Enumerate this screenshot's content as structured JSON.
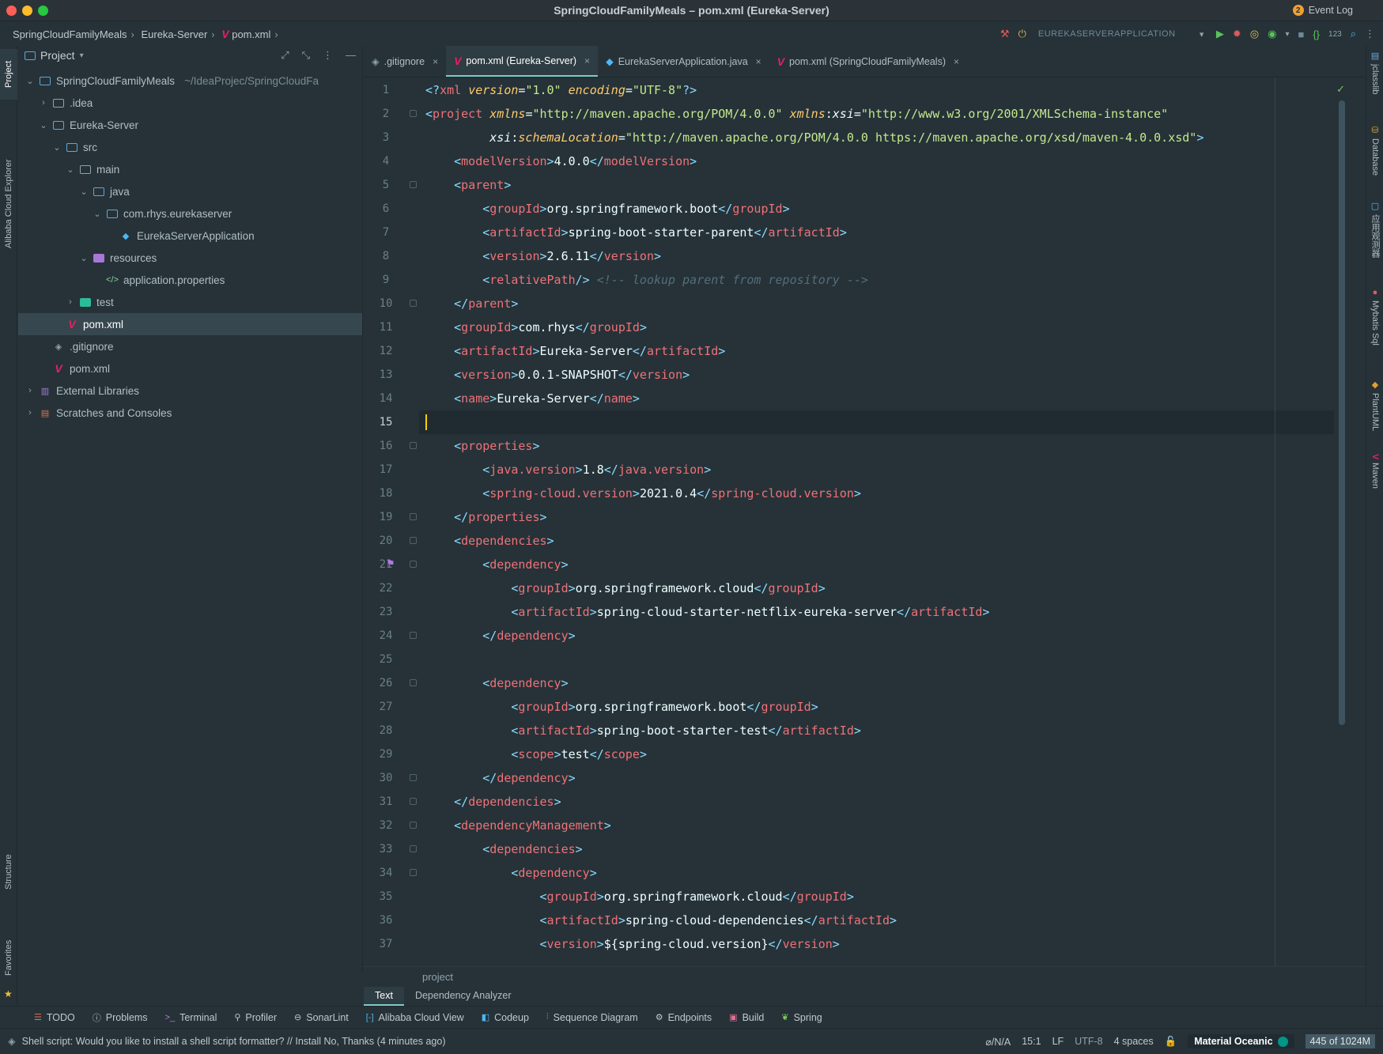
{
  "window": {
    "title": "SpringCloudFamilyMeals – pom.xml (Eureka-Server)"
  },
  "breadcrumb": [
    "SpringCloudFamilyMeals",
    "Eureka-Server",
    "pom.xml"
  ],
  "toolbar": {
    "run_config": "EUREKASERVERAPPLICATION",
    "counter_label": "123"
  },
  "left_strip": {
    "project": "Project",
    "alibaba": "Alibaba Cloud Explorer",
    "structure": "Structure",
    "favorites": "Favorites"
  },
  "project_panel": {
    "title": "Project",
    "tree": [
      {
        "label": "SpringCloudFamilyMeals",
        "hint": "~/IdeaProjec/SpringCloudFa",
        "depth": 0,
        "expanded": true,
        "icon": "module-folder"
      },
      {
        "label": ".idea",
        "depth": 1,
        "expanded": false,
        "icon": "folder"
      },
      {
        "label": "Eureka-Server",
        "depth": 1,
        "expanded": true,
        "icon": "module-folder"
      },
      {
        "label": "src",
        "depth": 2,
        "expanded": true,
        "icon": "source-folder"
      },
      {
        "label": "main",
        "depth": 3,
        "expanded": true,
        "icon": "folder"
      },
      {
        "label": "java",
        "depth": 4,
        "expanded": true,
        "icon": "source-folder"
      },
      {
        "label": "com.rhys.eurekaserver",
        "depth": 5,
        "expanded": true,
        "icon": "package"
      },
      {
        "label": "EurekaServerApplication",
        "depth": 6,
        "icon": "spring-class"
      },
      {
        "label": "resources",
        "depth": 4,
        "expanded": true,
        "icon": "resources-folder"
      },
      {
        "label": "application.properties",
        "depth": 5,
        "icon": "properties-file"
      },
      {
        "label": "test",
        "depth": 3,
        "expanded": false,
        "icon": "test-folder"
      },
      {
        "label": "pom.xml",
        "depth": 2,
        "icon": "maven-file",
        "selected": true
      },
      {
        "label": ".gitignore",
        "depth": 1,
        "icon": "gitignore-file"
      },
      {
        "label": "pom.xml",
        "depth": 1,
        "icon": "maven-file"
      },
      {
        "label": "External Libraries",
        "depth": 0,
        "expanded": false,
        "icon": "libraries"
      },
      {
        "label": "Scratches and Consoles",
        "depth": 0,
        "expanded": false,
        "icon": "scratches"
      }
    ]
  },
  "editor_tabs": [
    {
      "label": ".gitignore",
      "icon": "gitignore-file",
      "active": false
    },
    {
      "label": "pom.xml (Eureka-Server)",
      "icon": "maven-file",
      "active": true
    },
    {
      "label": "EurekaServerApplication.java",
      "icon": "spring-class",
      "active": false
    },
    {
      "label": "pom.xml (SpringCloudFamilyMeals)",
      "icon": "maven-file",
      "active": false
    }
  ],
  "editor": {
    "current_line": 15,
    "lines": [
      [
        [
          "b",
          "<?"
        ],
        [
          "t",
          "xml "
        ],
        [
          "a",
          "version"
        ],
        [
          "x",
          "="
        ],
        [
          "s",
          "\"1.0\""
        ],
        [
          "x",
          " "
        ],
        [
          "a",
          "encoding"
        ],
        [
          "x",
          "="
        ],
        [
          "s",
          "\"UTF-8\""
        ],
        [
          "b",
          "?>"
        ]
      ],
      [
        [
          "b",
          "<"
        ],
        [
          "t",
          "project "
        ],
        [
          "a",
          "xmlns"
        ],
        [
          "x",
          "="
        ],
        [
          "s",
          "\"http://maven.apache.org/POM/4.0.0\""
        ],
        [
          "x",
          " "
        ],
        [
          "a",
          "xmlns"
        ],
        [
          "x",
          ":"
        ],
        [
          "n",
          "xsi"
        ],
        [
          "x",
          "="
        ],
        [
          "s",
          "\"http://www.w3.org/2001/XMLSchema-instance\""
        ]
      ],
      [
        [
          "x",
          "         "
        ],
        [
          "n",
          "xsi"
        ],
        [
          "x",
          ":"
        ],
        [
          "a",
          "schemaLocation"
        ],
        [
          "x",
          "="
        ],
        [
          "s",
          "\"http://maven.apache.org/POM/4.0.0 https://maven.apache.org/xsd/maven-4.0.0.xsd\""
        ],
        [
          "b",
          ">"
        ]
      ],
      [
        [
          "x",
          "    "
        ],
        [
          "b",
          "<"
        ],
        [
          "t",
          "modelVersion"
        ],
        [
          "b",
          ">"
        ],
        [
          "x",
          "4.0.0"
        ],
        [
          "b",
          "</"
        ],
        [
          "t",
          "modelVersion"
        ],
        [
          "b",
          ">"
        ]
      ],
      [
        [
          "x",
          "    "
        ],
        [
          "b",
          "<"
        ],
        [
          "t",
          "parent"
        ],
        [
          "b",
          ">"
        ]
      ],
      [
        [
          "x",
          "        "
        ],
        [
          "b",
          "<"
        ],
        [
          "t",
          "groupId"
        ],
        [
          "b",
          ">"
        ],
        [
          "x",
          "org.springframework.boot"
        ],
        [
          "b",
          "</"
        ],
        [
          "t",
          "groupId"
        ],
        [
          "b",
          ">"
        ]
      ],
      [
        [
          "x",
          "        "
        ],
        [
          "b",
          "<"
        ],
        [
          "t",
          "artifactId"
        ],
        [
          "b",
          ">"
        ],
        [
          "x",
          "spring-boot-starter-parent"
        ],
        [
          "b",
          "</"
        ],
        [
          "t",
          "artifactId"
        ],
        [
          "b",
          ">"
        ]
      ],
      [
        [
          "x",
          "        "
        ],
        [
          "b",
          "<"
        ],
        [
          "t",
          "version"
        ],
        [
          "b",
          ">"
        ],
        [
          "x",
          "2.6.11"
        ],
        [
          "b",
          "</"
        ],
        [
          "t",
          "version"
        ],
        [
          "b",
          ">"
        ]
      ],
      [
        [
          "x",
          "        "
        ],
        [
          "b",
          "<"
        ],
        [
          "t",
          "relativePath"
        ],
        [
          "b",
          "/>"
        ],
        [
          "x",
          " "
        ],
        [
          "c",
          "<!-- lookup parent from repository -->"
        ]
      ],
      [
        [
          "x",
          "    "
        ],
        [
          "b",
          "</"
        ],
        [
          "t",
          "parent"
        ],
        [
          "b",
          ">"
        ]
      ],
      [
        [
          "x",
          "    "
        ],
        [
          "b",
          "<"
        ],
        [
          "t",
          "groupId"
        ],
        [
          "b",
          ">"
        ],
        [
          "x",
          "com.rhys"
        ],
        [
          "b",
          "</"
        ],
        [
          "t",
          "groupId"
        ],
        [
          "b",
          ">"
        ]
      ],
      [
        [
          "x",
          "    "
        ],
        [
          "b",
          "<"
        ],
        [
          "t",
          "artifactId"
        ],
        [
          "b",
          ">"
        ],
        [
          "x",
          "Eureka-Server"
        ],
        [
          "b",
          "</"
        ],
        [
          "t",
          "artifactId"
        ],
        [
          "b",
          ">"
        ]
      ],
      [
        [
          "x",
          "    "
        ],
        [
          "b",
          "<"
        ],
        [
          "t",
          "version"
        ],
        [
          "b",
          ">"
        ],
        [
          "x",
          "0.0.1-SNAPSHOT"
        ],
        [
          "b",
          "</"
        ],
        [
          "t",
          "version"
        ],
        [
          "b",
          ">"
        ]
      ],
      [
        [
          "x",
          "    "
        ],
        [
          "b",
          "<"
        ],
        [
          "t",
          "name"
        ],
        [
          "b",
          ">"
        ],
        [
          "x",
          "Eureka-Server"
        ],
        [
          "b",
          "</"
        ],
        [
          "t",
          "name"
        ],
        [
          "b",
          ">"
        ]
      ],
      [],
      [
        [
          "x",
          "    "
        ],
        [
          "b",
          "<"
        ],
        [
          "t",
          "properties"
        ],
        [
          "b",
          ">"
        ]
      ],
      [
        [
          "x",
          "        "
        ],
        [
          "b",
          "<"
        ],
        [
          "t",
          "java.version"
        ],
        [
          "b",
          ">"
        ],
        [
          "x",
          "1.8"
        ],
        [
          "b",
          "</"
        ],
        [
          "t",
          "java.version"
        ],
        [
          "b",
          ">"
        ]
      ],
      [
        [
          "x",
          "        "
        ],
        [
          "b",
          "<"
        ],
        [
          "t",
          "spring-cloud.version"
        ],
        [
          "b",
          ">"
        ],
        [
          "x",
          "2021.0.4"
        ],
        [
          "b",
          "</"
        ],
        [
          "t",
          "spring-cloud.version"
        ],
        [
          "b",
          ">"
        ]
      ],
      [
        [
          "x",
          "    "
        ],
        [
          "b",
          "</"
        ],
        [
          "t",
          "properties"
        ],
        [
          "b",
          ">"
        ]
      ],
      [
        [
          "x",
          "    "
        ],
        [
          "b",
          "<"
        ],
        [
          "t",
          "dependencies"
        ],
        [
          "b",
          ">"
        ]
      ],
      [
        [
          "x",
          "        "
        ],
        [
          "b",
          "<"
        ],
        [
          "t",
          "dependency"
        ],
        [
          "b",
          ">"
        ]
      ],
      [
        [
          "x",
          "            "
        ],
        [
          "b",
          "<"
        ],
        [
          "t",
          "groupId"
        ],
        [
          "b",
          ">"
        ],
        [
          "x",
          "org.springframework.cloud"
        ],
        [
          "b",
          "</"
        ],
        [
          "t",
          "groupId"
        ],
        [
          "b",
          ">"
        ]
      ],
      [
        [
          "x",
          "            "
        ],
        [
          "b",
          "<"
        ],
        [
          "t",
          "artifactId"
        ],
        [
          "b",
          ">"
        ],
        [
          "x",
          "spring-cloud-starter-netflix-eureka-server"
        ],
        [
          "b",
          "</"
        ],
        [
          "t",
          "artifactId"
        ],
        [
          "b",
          ">"
        ]
      ],
      [
        [
          "x",
          "        "
        ],
        [
          "b",
          "</"
        ],
        [
          "t",
          "dependency"
        ],
        [
          "b",
          ">"
        ]
      ],
      [],
      [
        [
          "x",
          "        "
        ],
        [
          "b",
          "<"
        ],
        [
          "t",
          "dependency"
        ],
        [
          "b",
          ">"
        ]
      ],
      [
        [
          "x",
          "            "
        ],
        [
          "b",
          "<"
        ],
        [
          "t",
          "groupId"
        ],
        [
          "b",
          ">"
        ],
        [
          "x",
          "org.springframework.boot"
        ],
        [
          "b",
          "</"
        ],
        [
          "t",
          "groupId"
        ],
        [
          "b",
          ">"
        ]
      ],
      [
        [
          "x",
          "            "
        ],
        [
          "b",
          "<"
        ],
        [
          "t",
          "artifactId"
        ],
        [
          "b",
          ">"
        ],
        [
          "x",
          "spring-boot-starter-test"
        ],
        [
          "b",
          "</"
        ],
        [
          "t",
          "artifactId"
        ],
        [
          "b",
          ">"
        ]
      ],
      [
        [
          "x",
          "            "
        ],
        [
          "b",
          "<"
        ],
        [
          "t",
          "scope"
        ],
        [
          "b",
          ">"
        ],
        [
          "x",
          "test"
        ],
        [
          "b",
          "</"
        ],
        [
          "t",
          "scope"
        ],
        [
          "b",
          ">"
        ]
      ],
      [
        [
          "x",
          "        "
        ],
        [
          "b",
          "</"
        ],
        [
          "t",
          "dependency"
        ],
        [
          "b",
          ">"
        ]
      ],
      [
        [
          "x",
          "    "
        ],
        [
          "b",
          "</"
        ],
        [
          "t",
          "dependencies"
        ],
        [
          "b",
          ">"
        ]
      ],
      [
        [
          "x",
          "    "
        ],
        [
          "b",
          "<"
        ],
        [
          "t",
          "dependencyManagement"
        ],
        [
          "b",
          ">"
        ]
      ],
      [
        [
          "x",
          "        "
        ],
        [
          "b",
          "<"
        ],
        [
          "t",
          "dependencies"
        ],
        [
          "b",
          ">"
        ]
      ],
      [
        [
          "x",
          "            "
        ],
        [
          "b",
          "<"
        ],
        [
          "t",
          "dependency"
        ],
        [
          "b",
          ">"
        ]
      ],
      [
        [
          "x",
          "                "
        ],
        [
          "b",
          "<"
        ],
        [
          "t",
          "groupId"
        ],
        [
          "b",
          ">"
        ],
        [
          "x",
          "org.springframework.cloud"
        ],
        [
          "b",
          "</"
        ],
        [
          "t",
          "groupId"
        ],
        [
          "b",
          ">"
        ]
      ],
      [
        [
          "x",
          "                "
        ],
        [
          "b",
          "<"
        ],
        [
          "t",
          "artifactId"
        ],
        [
          "b",
          ">"
        ],
        [
          "x",
          "spring-cloud-dependencies"
        ],
        [
          "b",
          "</"
        ],
        [
          "t",
          "artifactId"
        ],
        [
          "b",
          ">"
        ]
      ],
      [
        [
          "x",
          "                "
        ],
        [
          "b",
          "<"
        ],
        [
          "t",
          "version"
        ],
        [
          "b",
          ">"
        ],
        [
          "x",
          "${spring-cloud.version}"
        ],
        [
          "b",
          "</"
        ],
        [
          "t",
          "version"
        ],
        [
          "b",
          ">"
        ]
      ]
    ],
    "fold_lines": [
      2,
      5,
      10,
      16,
      19,
      20,
      21,
      24,
      26,
      30,
      31,
      32,
      33,
      34
    ],
    "breadcrumb": "project"
  },
  "subtabs": [
    {
      "label": "Text",
      "active": true
    },
    {
      "label": "Dependency Analyzer",
      "active": false
    }
  ],
  "right_strip": [
    "jclasslib",
    "Database",
    "应用观测器",
    "Mybatis Sql",
    "PlantUML",
    "Maven"
  ],
  "tool_windows": [
    {
      "label": "TODO",
      "icon": "todo-icon"
    },
    {
      "label": "Problems",
      "icon": "problems-icon"
    },
    {
      "label": "Terminal",
      "icon": "terminal-icon"
    },
    {
      "label": "Profiler",
      "icon": "profiler-icon"
    },
    {
      "label": "SonarLint",
      "icon": "sonarlint-icon"
    },
    {
      "label": "Alibaba Cloud View",
      "icon": "alibaba-icon"
    },
    {
      "label": "Codeup",
      "icon": "codeup-icon"
    },
    {
      "label": "Sequence Diagram",
      "icon": "sequence-icon"
    },
    {
      "label": "Endpoints",
      "icon": "endpoints-icon"
    },
    {
      "label": "Build",
      "icon": "build-icon"
    },
    {
      "label": "Spring",
      "icon": "spring-icon"
    }
  ],
  "event_log": {
    "label": "Event Log",
    "count": "2"
  },
  "status": {
    "message": "Shell script: Would you like to install a shell script formatter? // Install    No, Thanks (4 minutes ago)",
    "vcs": "⌀/N/A",
    "position": "15:1",
    "line_sep": "LF",
    "encoding": "UTF-8",
    "indent": "4 spaces",
    "theme": "Material Oceanic",
    "memory": "445 of 1024M"
  },
  "colors": {
    "background": "#263238",
    "accent": "#80cbc4",
    "caret": "#ffcc00",
    "tag": "#f07178",
    "bracket": "#89ddff",
    "attr": "#ffcb6b",
    "string": "#c3e88d"
  }
}
